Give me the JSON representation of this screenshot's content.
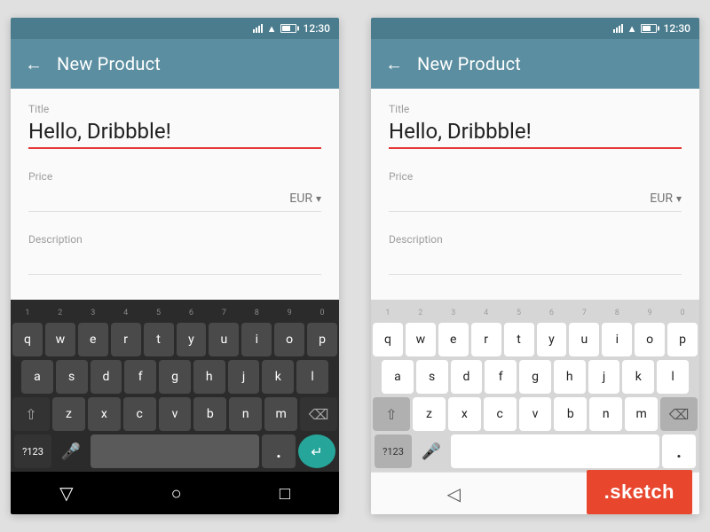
{
  "app": {
    "title": "New Product",
    "back_label": "←"
  },
  "status_bar": {
    "time": "12:30"
  },
  "form": {
    "title_label": "Title",
    "title_value": "Hello, Dribbble!",
    "price_label": "Price",
    "price_value": "",
    "currency": "EUR",
    "description_label": "Description",
    "description_value": ""
  },
  "keyboard": {
    "rows": [
      [
        "q",
        "w",
        "e",
        "r",
        "t",
        "y",
        "u",
        "i",
        "o",
        "p"
      ],
      [
        "a",
        "s",
        "d",
        "f",
        "g",
        "h",
        "j",
        "k",
        "l"
      ],
      [
        "z",
        "x",
        "c",
        "v",
        "b",
        "n",
        "m"
      ]
    ],
    "numbers": [
      "1",
      "2",
      "3",
      "4",
      "5",
      "6",
      "7",
      "8",
      "9",
      "0"
    ],
    "special": {
      "shift": "⇧",
      "backspace": "⌫",
      "num": "?123",
      "mic": "🎤",
      "dot": ".",
      "enter": "↵"
    }
  },
  "nav": {
    "back": "◁",
    "home": "○",
    "recent": "□"
  },
  "sketch_badge": {
    "label": ".sketch"
  }
}
